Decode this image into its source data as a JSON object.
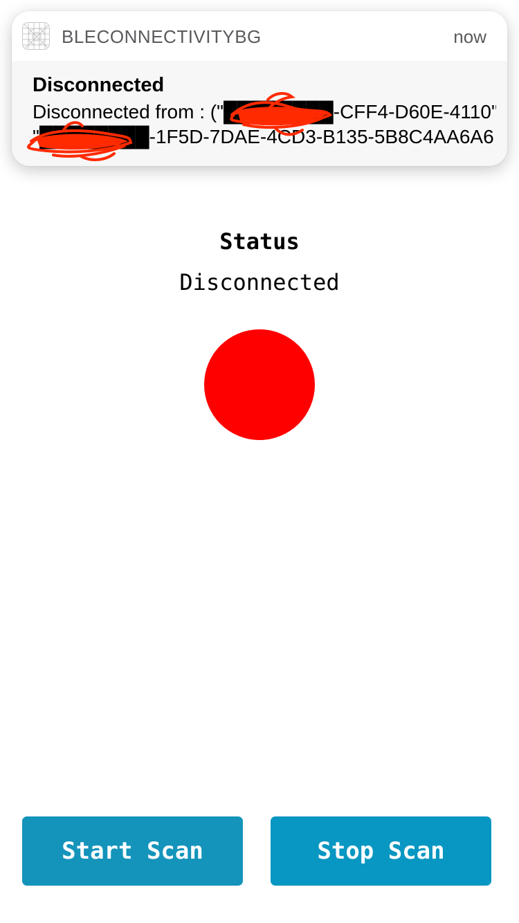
{
  "notification": {
    "app_name": "BLECONNECTIVITYBG",
    "time": "now",
    "title": "Disconnected",
    "body_line1": "Disconnected from : (\"████████-CFF4-D60E-4110\",",
    "body_line2": "\"████████-1F5D-7DAE-4CD3-B135-5B8C4AA6A6…",
    "icon": "app-grid-icon"
  },
  "status": {
    "label": "Status",
    "value": "Disconnected",
    "indicator_color": "#ff0000"
  },
  "buttons": {
    "start_label": "Start Scan",
    "stop_label": "Stop Scan",
    "start_color": "#1494bb",
    "stop_color": "#0897c2"
  },
  "colors": {
    "redaction": "#ff2a00"
  }
}
